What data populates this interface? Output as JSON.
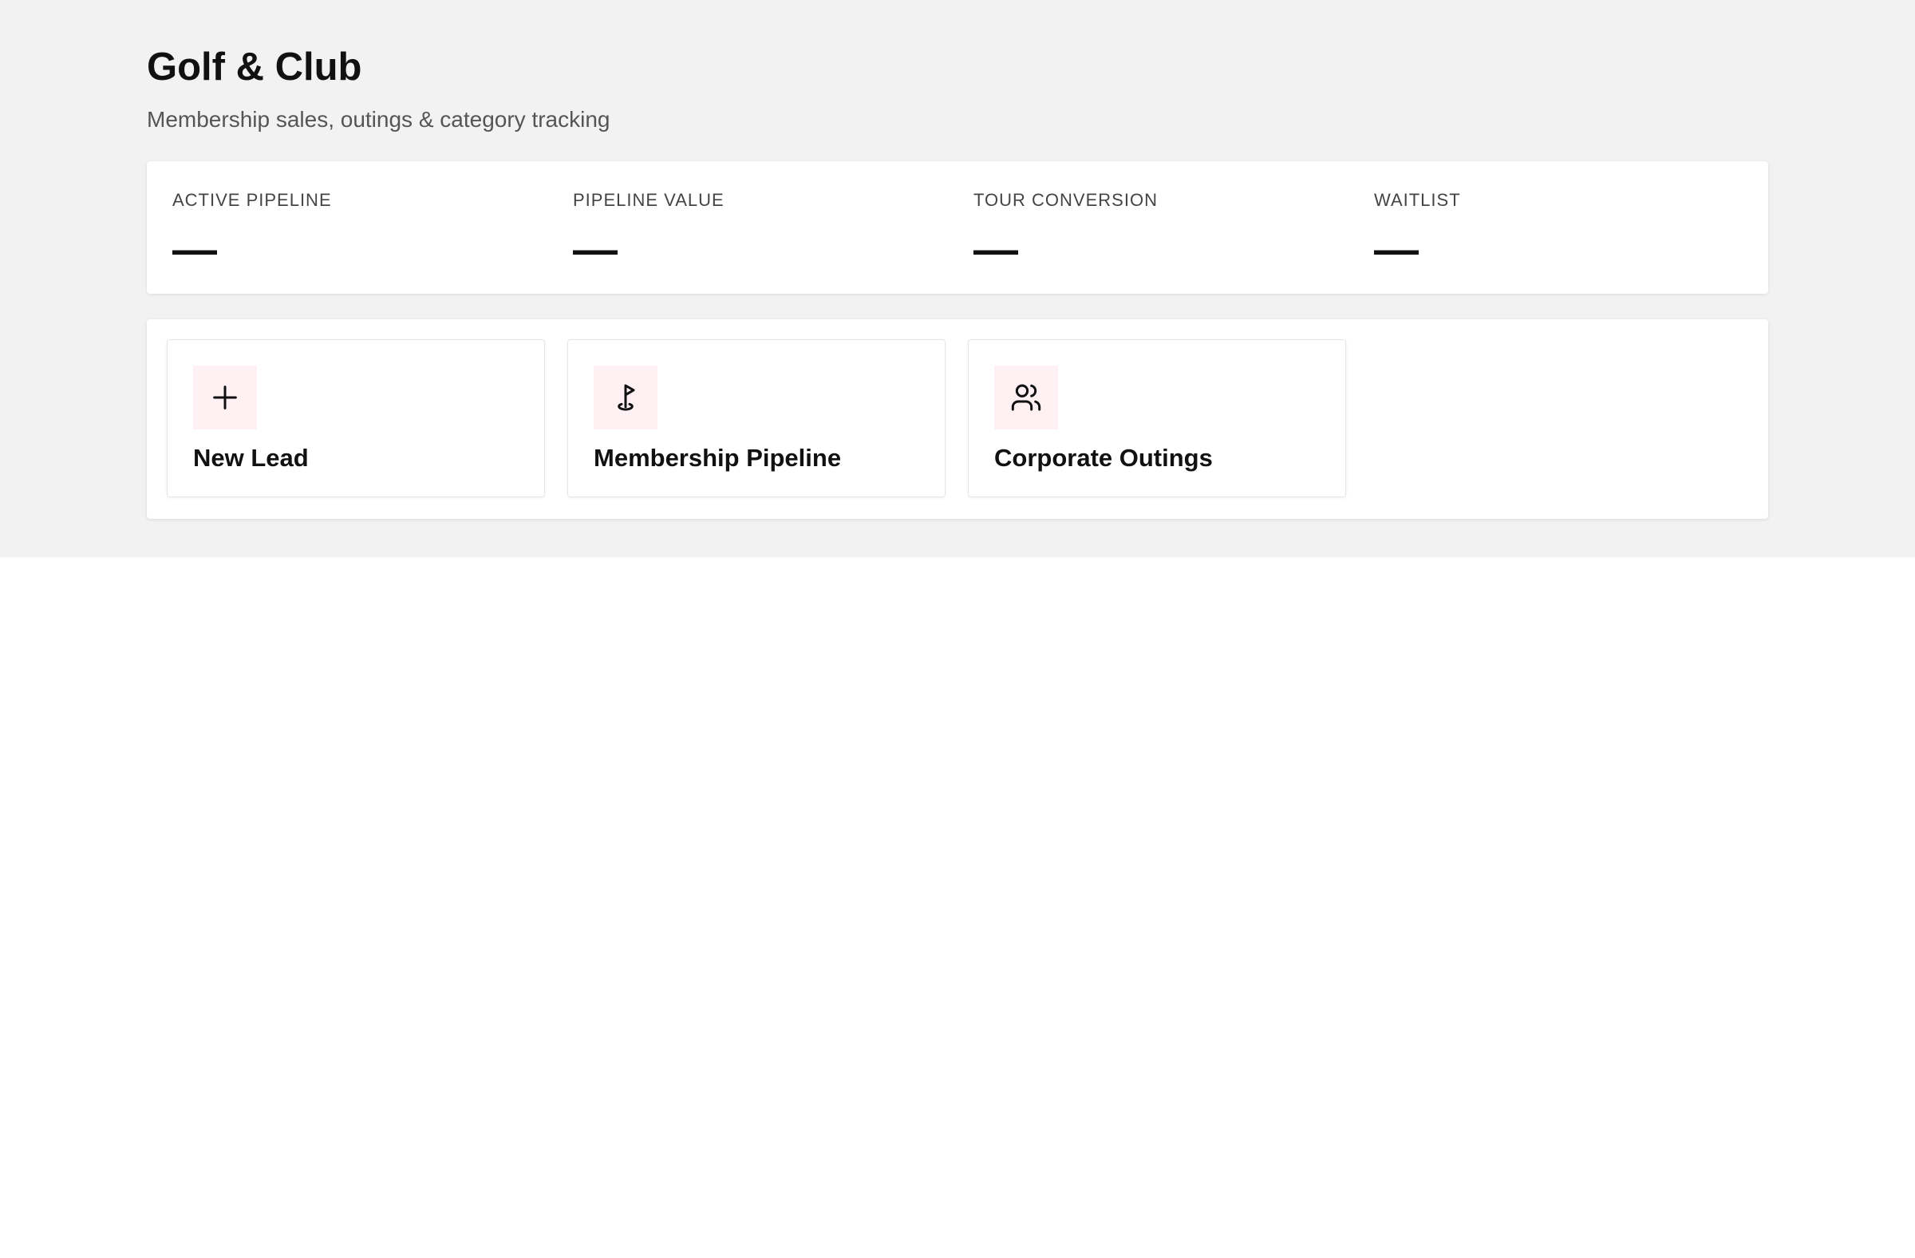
{
  "header": {
    "title": "Golf & Club",
    "subtitle": "Membership sales, outings & category tracking"
  },
  "stats": [
    {
      "label": "ACTIVE PIPELINE",
      "value": "—"
    },
    {
      "label": "PIPELINE VALUE",
      "value": "—"
    },
    {
      "label": "TOUR CONVERSION",
      "value": "—"
    },
    {
      "label": "WAITLIST",
      "value": "—"
    }
  ],
  "actions": [
    {
      "label": "New Lead",
      "icon": "plus-icon"
    },
    {
      "label": "Membership Pipeline",
      "icon": "golf-flag-icon"
    },
    {
      "label": "Corporate Outings",
      "icon": "users-icon"
    }
  ],
  "colors": {
    "header_background": "#f2f2f2",
    "icon_tile_background": "#fff0f3",
    "text_primary": "#111111",
    "text_secondary": "#555555"
  }
}
